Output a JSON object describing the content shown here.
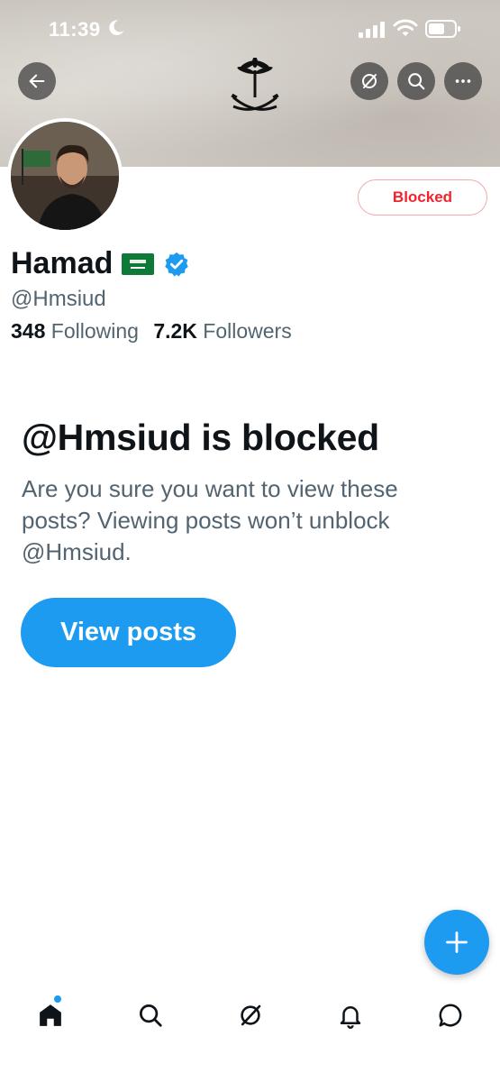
{
  "status_bar": {
    "time": "11:39",
    "moon_icon": "moon-icon",
    "signal_icon": "signal-icon",
    "wifi_icon": "wifi-icon",
    "battery_icon": "battery-icon"
  },
  "header": {
    "back_icon": "arrow-left-icon",
    "grok_icon": "grok-icon",
    "search_icon": "search-icon",
    "more_icon": "more-icon",
    "emblem_icon": "palm-swords-emblem-icon"
  },
  "profile": {
    "name": "Hamad",
    "handle": "@Hmsiud",
    "blocked_label": "Blocked",
    "following_count": "348",
    "following_label": "Following",
    "followers_count": "7.2K",
    "followers_label": "Followers",
    "flag_icon": "saudi-flag-icon",
    "verified_icon": "verified-badge-icon"
  },
  "blocked_notice": {
    "title": "@Hmsiud is blocked",
    "description": "Are you sure you want to view these posts? Viewing posts won’t unblock @Hmsiud.",
    "view_button": "View posts"
  },
  "fab": {
    "icon": "plus-icon"
  },
  "tabbar": {
    "items": [
      {
        "name": "home",
        "icon": "home-icon",
        "active": true,
        "badge": true
      },
      {
        "name": "search",
        "icon": "search-icon"
      },
      {
        "name": "grok",
        "icon": "grok-icon"
      },
      {
        "name": "notifications",
        "icon": "bell-icon"
      },
      {
        "name": "messages",
        "icon": "message-icon"
      }
    ]
  },
  "colors": {
    "accent": "#1d9bf0",
    "blocked_red": "#f4212e",
    "secondary_text": "#536471",
    "primary_text": "#0f1419"
  }
}
